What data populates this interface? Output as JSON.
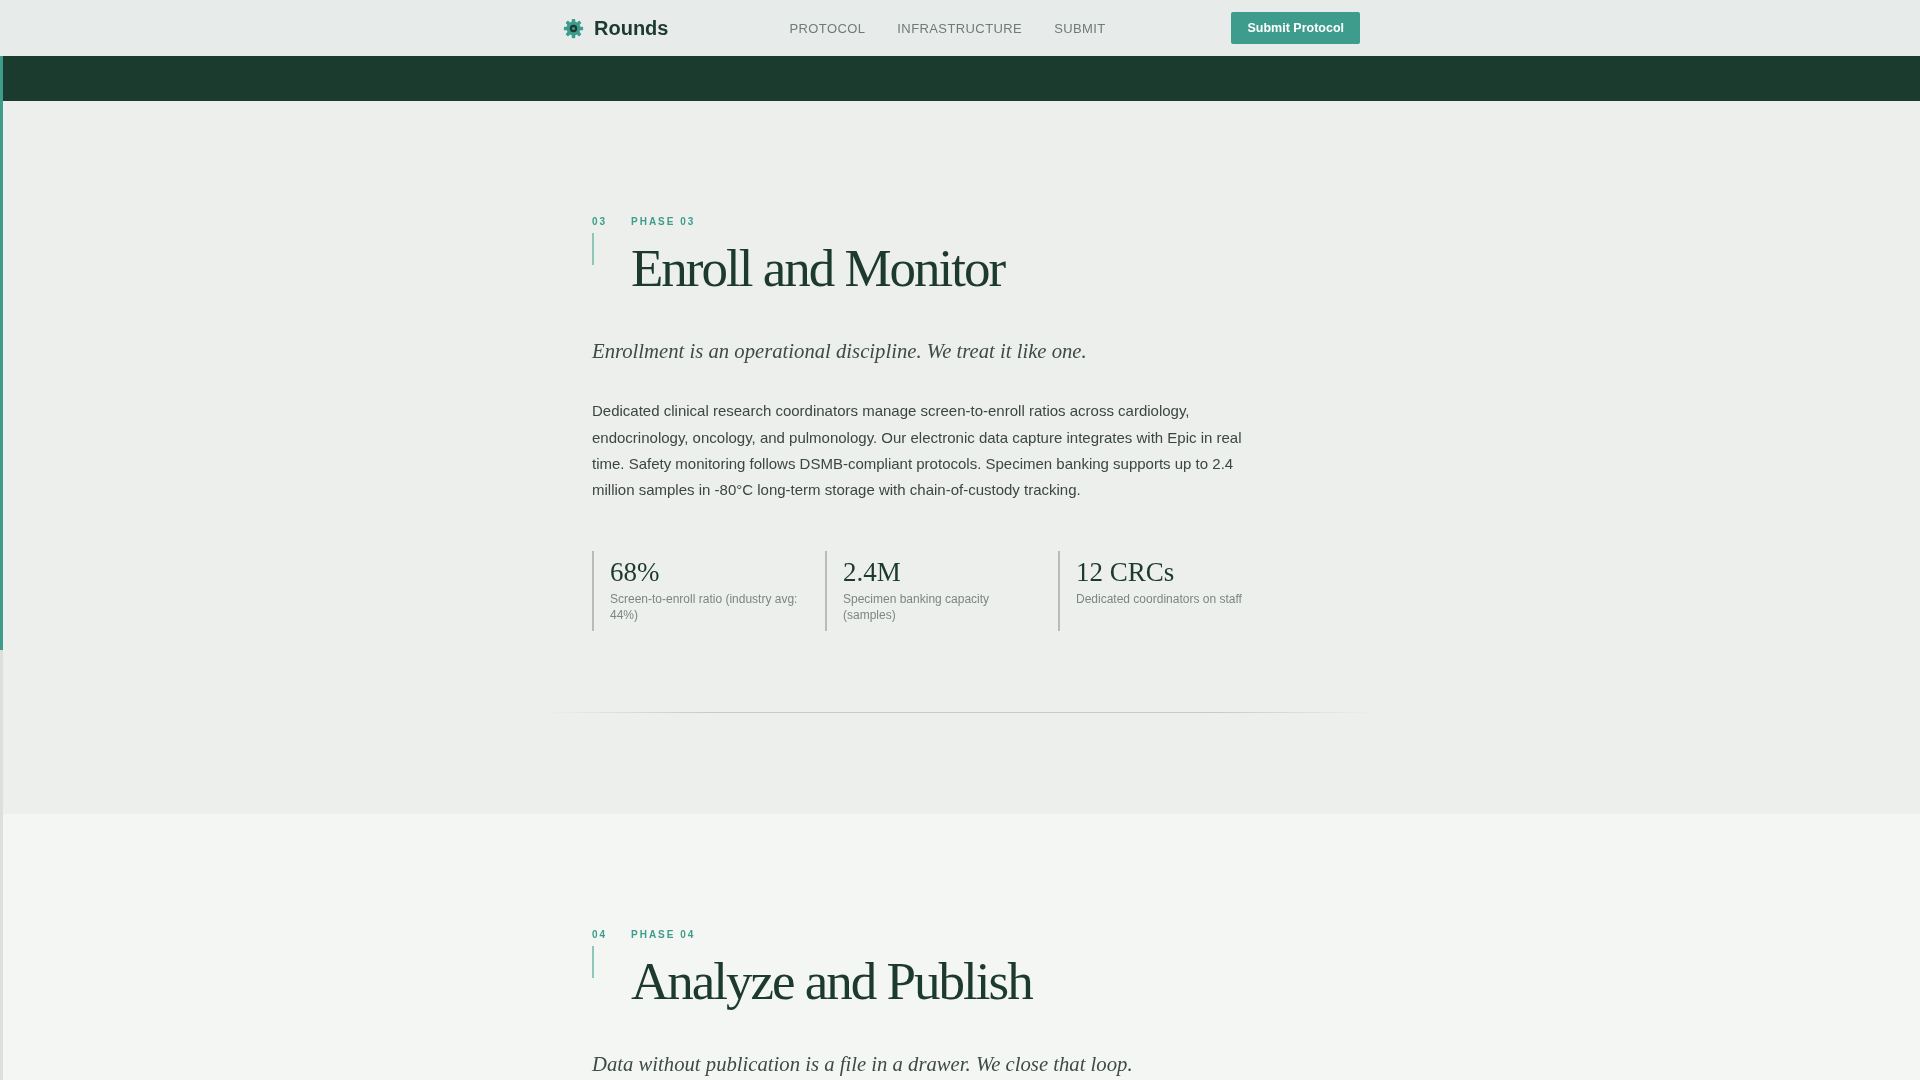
{
  "nav": {
    "brand": "Rounds",
    "links": [
      {
        "label": "PROTOCOL"
      },
      {
        "label": "INFRASTRUCTURE"
      },
      {
        "label": "SUBMIT"
      }
    ],
    "cta": "Submit Protocol"
  },
  "reading_progress": {
    "level": 0.58
  },
  "phases": [
    {
      "number": "03",
      "label": "PHASE 03",
      "title": "Enroll and Monitor",
      "lede": "Enrollment is an operational discipline. We treat it like one.",
      "body": "Dedicated clinical research coordinators manage screen-to-enroll ratios across cardiology, endocrinology, oncology, and pulmonology. Our electronic data capture integrates with Epic in real time. Safety monitoring follows DSMB-compliant protocols. Specimen banking supports up to 2.4 million samples in -80°C long-term storage with chain-of-custody tracking.",
      "stats": [
        {
          "value": "68%",
          "label": "Screen-to-enroll ratio (industry avg: 44%)"
        },
        {
          "value": "2.4M",
          "label": "Specimen banking capacity (samples)"
        },
        {
          "value": "12 CRCs",
          "label": "Dedicated coordinators on staff"
        }
      ]
    },
    {
      "number": "04",
      "label": "PHASE 04",
      "title": "Analyze and Publish",
      "lede": "Data without publication is a file in a drawer. We close that loop."
    }
  ]
}
